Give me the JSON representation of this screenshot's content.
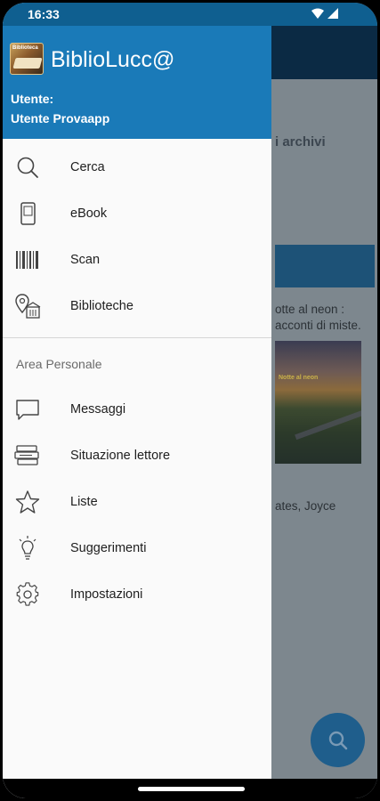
{
  "status_bar": {
    "time": "16:33"
  },
  "drawer": {
    "app_name": "BiblioLucc@",
    "logo_text": "Biblioteca",
    "user_label": "Utente:",
    "user_name": "Utente Provaapp",
    "menu": [
      {
        "label": "Cerca",
        "icon": "search-icon"
      },
      {
        "label": "eBook",
        "icon": "ebook-icon"
      },
      {
        "label": "Scan",
        "icon": "barcode-icon"
      },
      {
        "label": "Biblioteche",
        "icon": "library-location-icon"
      }
    ],
    "section_title": "Area Personale",
    "personal_menu": [
      {
        "label": "Messaggi",
        "icon": "message-icon"
      },
      {
        "label": "Situazione lettore",
        "icon": "reader-status-icon"
      },
      {
        "label": "Liste",
        "icon": "star-icon"
      },
      {
        "label": "Suggerimenti",
        "icon": "lightbulb-icon"
      },
      {
        "label": "Impostazioni",
        "icon": "gear-icon"
      }
    ]
  },
  "background": {
    "heading": "i archivi",
    "book_title_line1": "otte al neon :",
    "book_title_line2": "acconti di miste.",
    "cover_text": "Notte al neon",
    "author": "ates, Joyce"
  },
  "colors": {
    "header": "#1a7ab8",
    "status_bar": "#0f5f90",
    "drawer_bg": "#fafafa",
    "fab": "#1f5e8c"
  }
}
